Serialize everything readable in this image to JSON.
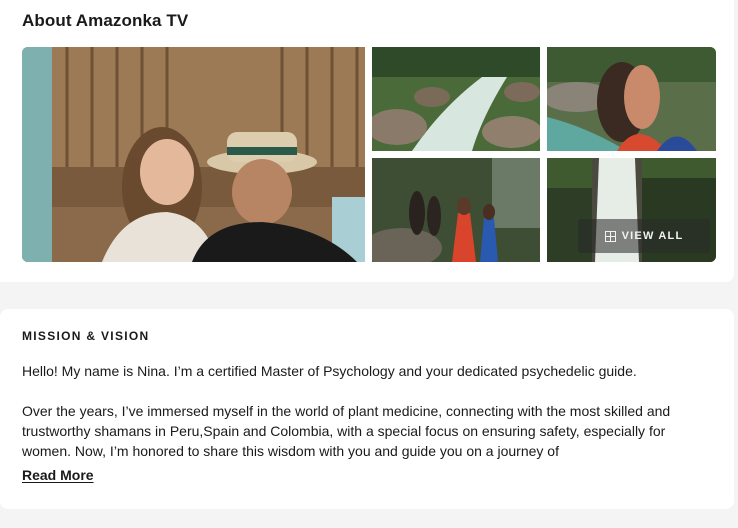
{
  "about": {
    "title": "About Amazonka TV",
    "view_all_label": "VIEW ALL",
    "view_all_icon": "grid-icon"
  },
  "mission": {
    "heading": "MISSION & VISION",
    "paragraph_1": "Hello! My name is Nina. I’m a certified Master of Psychology and your dedicated psychedelic guide.",
    "paragraph_2": "Over the years, I’ve immersed myself in the world of plant medicine, connecting with the most skilled and trustworthy shamans in Peru,Spain and Colombia, with a special focus on ensuring safety, especially for women. Now, I’m honored to share this wisdom with you and guide you on a journey of",
    "read_more_label": "Read More"
  },
  "colors": {
    "page_bg": "#f4f4f4",
    "card_bg": "#ffffff",
    "text": "#1a1a1a"
  }
}
